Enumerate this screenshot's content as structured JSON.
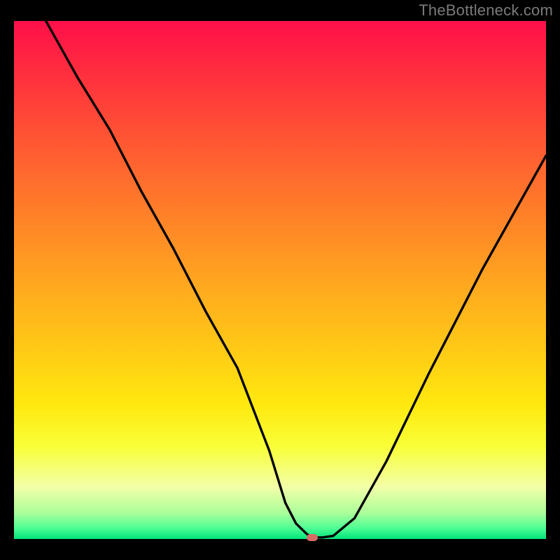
{
  "watermark": "TheBottleneck.com",
  "chart_data": {
    "type": "line",
    "title": "",
    "xlabel": "",
    "ylabel": "",
    "xlim": [
      0,
      100
    ],
    "ylim": [
      0,
      100
    ],
    "grid": false,
    "series": [
      {
        "name": "curve",
        "x": [
          6,
          12,
          18,
          24,
          30,
          36,
          42,
          48,
          51,
          53,
          55,
          56,
          58,
          60,
          64,
          70,
          78,
          88,
          100
        ],
        "y": [
          100,
          89,
          79,
          67,
          56,
          44,
          33,
          17,
          7,
          3,
          1,
          0.3,
          0.3,
          0.6,
          4,
          15,
          32,
          52,
          74
        ]
      }
    ],
    "marker": {
      "x": 56,
      "y": 0.3
    },
    "background_gradient": {
      "direction": "vertical",
      "stops": [
        {
          "pos": 0,
          "color": "#ff0f4a"
        },
        {
          "pos": 10,
          "color": "#ff2e3e"
        },
        {
          "pos": 24,
          "color": "#ff5932"
        },
        {
          "pos": 38,
          "color": "#ff8228"
        },
        {
          "pos": 50,
          "color": "#ffa520"
        },
        {
          "pos": 62,
          "color": "#ffc617"
        },
        {
          "pos": 74,
          "color": "#ffe80f"
        },
        {
          "pos": 82,
          "color": "#f8ff36"
        },
        {
          "pos": 90,
          "color": "#f3ffa8"
        },
        {
          "pos": 95,
          "color": "#aaff9a"
        },
        {
          "pos": 98,
          "color": "#4bfd94"
        },
        {
          "pos": 100,
          "color": "#00e47a"
        }
      ]
    }
  }
}
